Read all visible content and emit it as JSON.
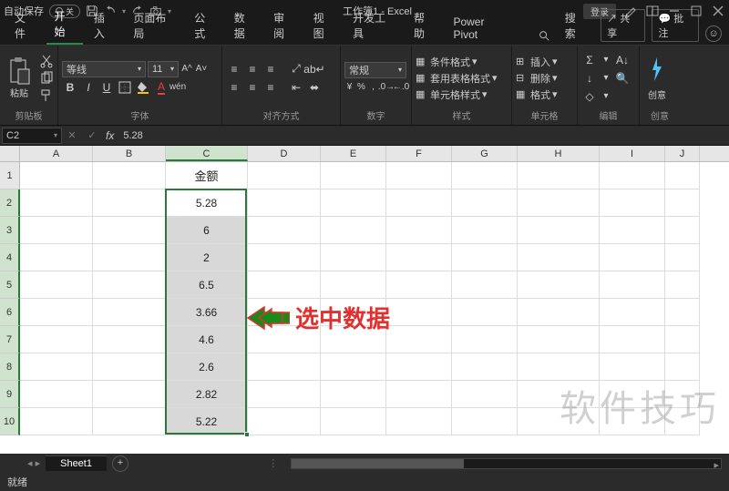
{
  "titlebar": {
    "autosave": "自动保存",
    "title": "工作簿1 - Excel",
    "login": "登录"
  },
  "tabs": {
    "items": [
      "文件",
      "开始",
      "插入",
      "页面布局",
      "公式",
      "数据",
      "审阅",
      "视图",
      "开发工具",
      "帮助",
      "Power Pivot"
    ],
    "active": 1,
    "search": "搜索",
    "share": "共享",
    "comments": "批注"
  },
  "ribbon": {
    "clipboard": {
      "paste": "粘贴",
      "label": "剪贴板"
    },
    "font": {
      "name": "等线",
      "size": "11",
      "label": "字体"
    },
    "align": {
      "label": "对齐方式"
    },
    "number": {
      "format": "常规",
      "label": "数字"
    },
    "styles": {
      "cond": "条件格式",
      "table": "套用表格格式",
      "cell": "单元格样式",
      "label": "样式"
    },
    "cells": {
      "insert": "插入",
      "delete": "删除",
      "format": "格式",
      "label": "单元格"
    },
    "editing": {
      "label": "编辑"
    },
    "create": {
      "btn": "创意",
      "label": "创意"
    }
  },
  "formula_bar": {
    "cell_ref": "C2",
    "value": "5.28"
  },
  "grid": {
    "col_widths": {
      "A": 80,
      "B": 80,
      "C": 90,
      "D": 80,
      "E": 72,
      "F": 72,
      "G": 72,
      "H": 90,
      "I": 72,
      "J": 38
    },
    "columns": [
      "A",
      "B",
      "C",
      "D",
      "E",
      "F",
      "G",
      "H",
      "I",
      "J"
    ],
    "rows": [
      1,
      2,
      3,
      4,
      5,
      6,
      7,
      8,
      9,
      10
    ],
    "header": "金额",
    "values": [
      "5.28",
      "6",
      "2",
      "6.5",
      "3.66",
      "4.6",
      "2.6",
      "2.82",
      "5.22"
    ],
    "selected_col": "C",
    "selected_rows_start": 2,
    "selected_rows_end": 10
  },
  "annotation": "选中数据",
  "watermark": "软件技巧",
  "sheet_tabs": {
    "active": "Sheet1"
  },
  "status": {
    "ready": "就绪"
  }
}
